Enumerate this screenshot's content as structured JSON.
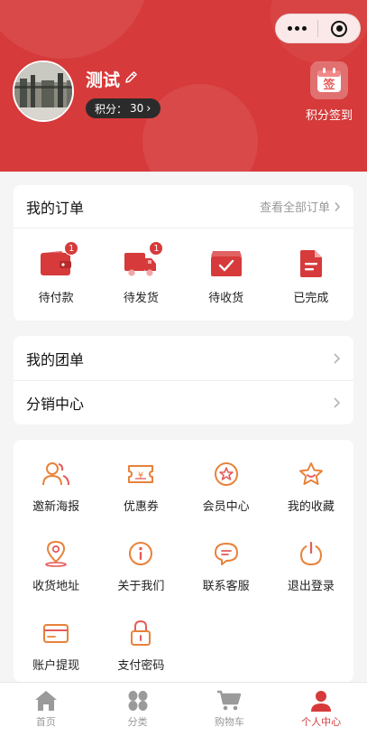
{
  "colors": {
    "brand": "#d63a3a",
    "muted": "#999999",
    "orange": "#e8823a"
  },
  "capsule": {
    "more_icon": "more-dots-icon",
    "close_icon": "target-close-icon"
  },
  "profile": {
    "name": "测试",
    "edit_icon": "edit-pencil-icon",
    "points_label": "积分：",
    "points_value": "30",
    "signin_icon_text": "签",
    "signin_label": "积分签到"
  },
  "orders": {
    "title": "我的订单",
    "view_all": "查看全部订单",
    "items": [
      {
        "label": "待付款",
        "icon": "wallet-icon",
        "badge": "1"
      },
      {
        "label": "待发货",
        "icon": "delivery-truck-icon",
        "badge": "1"
      },
      {
        "label": "待收货",
        "icon": "receive-box-icon",
        "badge": ""
      },
      {
        "label": "已完成",
        "icon": "completed-document-icon",
        "badge": ""
      }
    ]
  },
  "groups": {
    "items": [
      {
        "label": "我的团单"
      },
      {
        "label": "分销中心"
      }
    ]
  },
  "services": {
    "items": [
      {
        "label": "邀新海报",
        "icon": "invite-users-icon"
      },
      {
        "label": "优惠券",
        "icon": "coupon-ticket-icon"
      },
      {
        "label": "会员中心",
        "icon": "member-star-icon"
      },
      {
        "label": "我的收藏",
        "icon": "favorite-star-icon"
      },
      {
        "label": "收货地址",
        "icon": "location-pin-icon"
      },
      {
        "label": "关于我们",
        "icon": "info-icon"
      },
      {
        "label": "联系客服",
        "icon": "chat-bubble-icon"
      },
      {
        "label": "退出登录",
        "icon": "power-icon"
      },
      {
        "label": "账户提现",
        "icon": "bank-card-icon"
      },
      {
        "label": "支付密码",
        "icon": "lock-icon"
      }
    ]
  },
  "tabbar": {
    "items": [
      {
        "label": "首页",
        "icon": "home-icon",
        "active": false
      },
      {
        "label": "分类",
        "icon": "category-grid-icon",
        "active": false
      },
      {
        "label": "购物车",
        "icon": "shopping-cart-icon",
        "active": false
      },
      {
        "label": "个人中心",
        "icon": "user-profile-icon",
        "active": true
      }
    ]
  }
}
